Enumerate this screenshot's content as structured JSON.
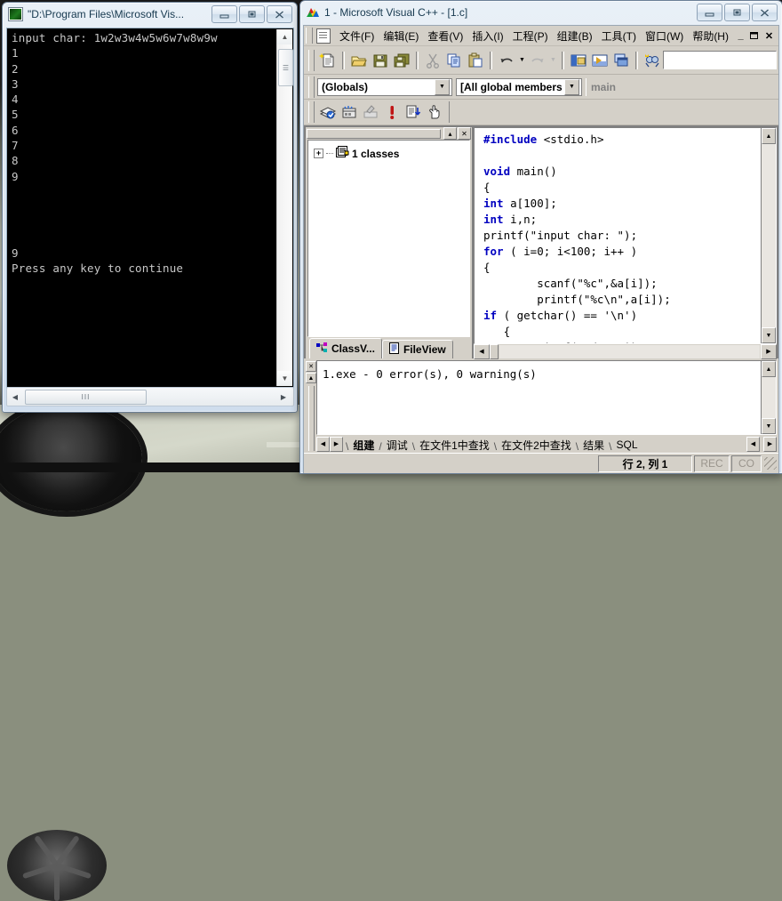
{
  "desktop": {
    "wallpaper_description": "car-photo-wallpaper"
  },
  "console": {
    "title": "\"D:\\Program Files\\Microsoft Vis...",
    "icon": "console-icon",
    "buttons": {
      "minimize": "minimize",
      "maximize": "maximize",
      "close": "close"
    },
    "output": "input char: 1w2w3w4w5w6w7w8w9w\n1\n2\n3\n4\n5\n6\n7\n8\n9\n\n\n\n\n9\nPress any key to continue",
    "hscroll_thumb_glyph": "III"
  },
  "vc": {
    "title": "1 - Microsoft Visual C++ - [1.c]",
    "buttons": {
      "minimize": "minimize",
      "maximize": "maximize",
      "close": "close"
    },
    "menu": [
      {
        "label": "文件(F)"
      },
      {
        "label": "编辑(E)"
      },
      {
        "label": "查看(V)"
      },
      {
        "label": "插入(I)"
      },
      {
        "label": "工程(P)"
      },
      {
        "label": "组建(B)"
      },
      {
        "label": "工具(T)"
      },
      {
        "label": "窗口(W)"
      },
      {
        "label": "帮助(H)"
      }
    ],
    "mdi_buttons": {
      "minimize": "_",
      "restore": "❐",
      "close": "✕"
    },
    "standard_toolbar": [
      {
        "name": "new-document-icon"
      },
      {
        "name": "open-folder-icon"
      },
      {
        "name": "save-icon"
      },
      {
        "name": "save-all-icon"
      },
      {
        "name": "cut-scissors-icon"
      },
      {
        "name": "copy-icon"
      },
      {
        "name": "paste-icon"
      },
      {
        "name": "undo-icon"
      },
      {
        "name": "redo-icon"
      },
      {
        "name": "workspace-icon"
      },
      {
        "name": "output-window-icon"
      },
      {
        "name": "window-list-icon"
      },
      {
        "name": "find-in-files-icon"
      }
    ],
    "find_placeholder": "",
    "find_value": "",
    "combo_globals": "(Globals)",
    "combo_members": "[All global members",
    "symbol_field": "main",
    "build_toolbar": [
      {
        "name": "compile-icon"
      },
      {
        "name": "build-icon"
      },
      {
        "name": "stop-build-icon"
      },
      {
        "name": "execute-program-icon"
      },
      {
        "name": "go-debug-icon"
      },
      {
        "name": "insert-breakpoint-icon"
      }
    ],
    "workspace": {
      "tree_root": "1 classes",
      "expander": "+",
      "tree_icon": "classes-folder-icon",
      "tabs": [
        {
          "label": "ClassV...",
          "icon": "classview-icon",
          "active": true
        },
        {
          "label": "FileView",
          "icon": "fileview-icon",
          "active": false
        }
      ],
      "caption_buttons": {
        "restore": "▴",
        "close": "✕"
      }
    },
    "code_lines": [
      [
        {
          "t": "#include",
          "k": true
        },
        {
          "t": " <stdio.h>",
          "k": false
        }
      ],
      [
        {
          "t": "",
          "k": false
        }
      ],
      [
        {
          "t": "void",
          "k": true
        },
        {
          "t": " main()",
          "k": false
        }
      ],
      [
        {
          "t": "{",
          "k": false
        }
      ],
      [
        {
          "t": "int",
          "k": true
        },
        {
          "t": " a[100];",
          "k": false
        }
      ],
      [
        {
          "t": "int",
          "k": true
        },
        {
          "t": " i,n;",
          "k": false
        }
      ],
      [
        {
          "t": "printf(\"input char: \");",
          "k": false
        }
      ],
      [
        {
          "t": "for",
          "k": true
        },
        {
          "t": " ( i=0; i<100; i++ )",
          "k": false
        }
      ],
      [
        {
          "t": "{",
          "k": false
        }
      ],
      [
        {
          "t": "        scanf(\"%c\",&a[i]);",
          "k": false
        }
      ],
      [
        {
          "t": "        printf(\"%c\\n\",a[i]);",
          "k": false
        }
      ],
      [
        {
          "t": "if",
          "k": true
        },
        {
          "t": " ( getchar() == '\\n')",
          "k": false
        }
      ],
      [
        {
          "t": "   {",
          "k": false
        }
      ],
      [
        {
          "t": "       printf(\"%d\\n\",i);",
          "k": false
        }
      ]
    ],
    "output_text": "1.exe - 0 error(s), 0 warning(s)",
    "output_tabs": [
      {
        "label": "组建",
        "active": true
      },
      {
        "label": "调试",
        "active": false
      },
      {
        "label": "在文件1中查找",
        "active": false
      },
      {
        "label": "在文件2中查找",
        "active": false
      },
      {
        "label": "结果",
        "active": false
      },
      {
        "label": "SQL",
        "active": false
      }
    ],
    "status": {
      "position": "行 2, 列 1",
      "rec": "REC",
      "col": "CO"
    }
  },
  "colors": {
    "keyword_blue": "#0000c0",
    "dialog_face": "#d4d0c8",
    "console_bg": "#000000",
    "console_fg": "#c8c8c8",
    "aero_title": "#16394f"
  }
}
